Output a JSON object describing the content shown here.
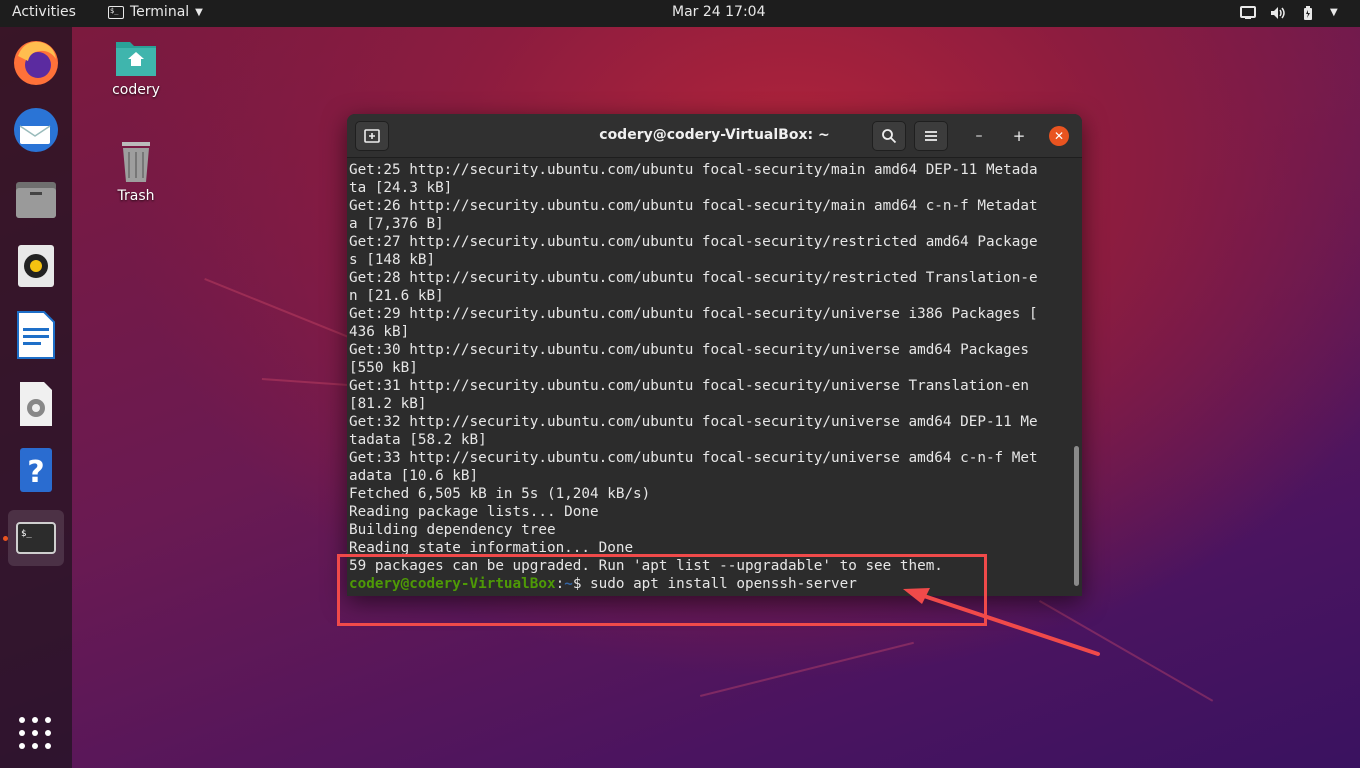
{
  "topbar": {
    "activities": "Activities",
    "app_menu": "Terminal",
    "clock": "Mar 24  17:04"
  },
  "desktop": {
    "home_folder": "codery",
    "trash": "Trash"
  },
  "dock": {
    "items": [
      "firefox",
      "thunderbird",
      "files",
      "rhythmbox",
      "libreoffice-writer",
      "software",
      "help",
      "terminal"
    ]
  },
  "window": {
    "title": "codery@codery-VirtualBox: ~"
  },
  "terminal": {
    "lines": [
      "Get:25 http://security.ubuntu.com/ubuntu focal-security/main amd64 DEP-11 Metada",
      "ta [24.3 kB]",
      "Get:26 http://security.ubuntu.com/ubuntu focal-security/main amd64 c-n-f Metadat",
      "a [7,376 B]",
      "Get:27 http://security.ubuntu.com/ubuntu focal-security/restricted amd64 Package",
      "s [148 kB]",
      "Get:28 http://security.ubuntu.com/ubuntu focal-security/restricted Translation-e",
      "n [21.6 kB]",
      "Get:29 http://security.ubuntu.com/ubuntu focal-security/universe i386 Packages [",
      "436 kB]",
      "Get:30 http://security.ubuntu.com/ubuntu focal-security/universe amd64 Packages",
      "[550 kB]",
      "Get:31 http://security.ubuntu.com/ubuntu focal-security/universe Translation-en",
      "[81.2 kB]",
      "Get:32 http://security.ubuntu.com/ubuntu focal-security/universe amd64 DEP-11 Me",
      "tadata [58.2 kB]",
      "Get:33 http://security.ubuntu.com/ubuntu focal-security/universe amd64 c-n-f Met",
      "adata [10.6 kB]",
      "Fetched 6,505 kB in 5s (1,204 kB/s)",
      "Reading package lists... Done",
      "Building dependency tree",
      "Reading state information... Done",
      "59 packages can be upgraded. Run 'apt list --upgradable' to see them."
    ],
    "prompt_user": "codery@codery-VirtualBox",
    "prompt_sep": ":",
    "prompt_path": "~",
    "prompt_symbol": "$ ",
    "command": "sudo apt install openssh-server"
  },
  "colors": {
    "accent": "#e95420",
    "annotation": "#f04a4a",
    "prompt_user": "#4e9a06",
    "prompt_path": "#3465a4"
  }
}
